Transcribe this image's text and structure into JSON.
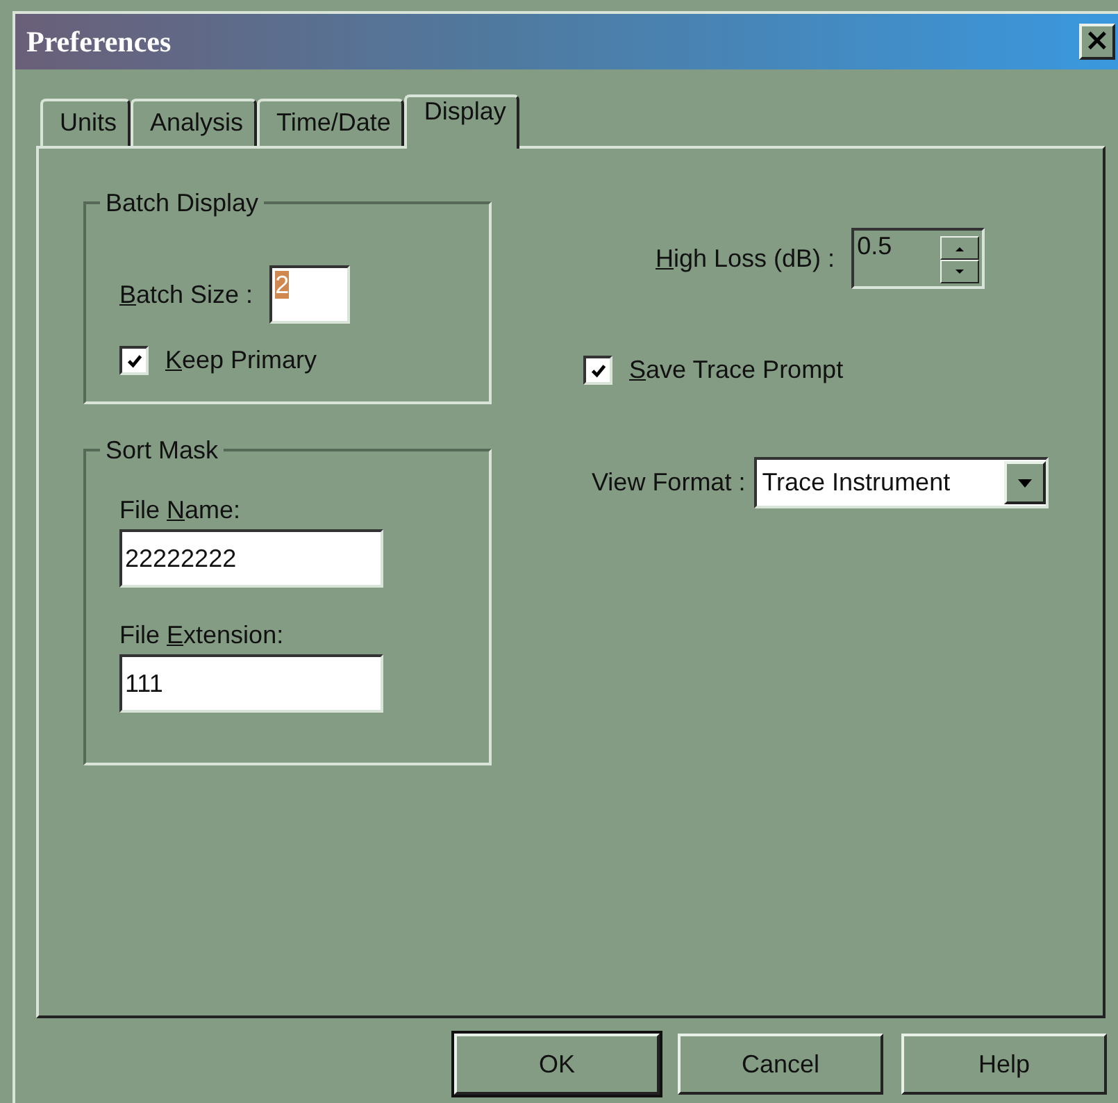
{
  "window": {
    "title": "Preferences",
    "close": "×"
  },
  "tabs": [
    {
      "label": "Units",
      "selected": false
    },
    {
      "label": "Analysis",
      "selected": false
    },
    {
      "label": "Time/Date",
      "selected": false
    },
    {
      "label": "Display",
      "selected": true
    }
  ],
  "batch_display": {
    "title": "Batch Display",
    "batch_size": {
      "accelerator": "B",
      "label_rest": "atch Size :",
      "value": "2",
      "highlighted": true
    },
    "keep_primary": {
      "accelerator": "K",
      "label_rest": "eep Primary",
      "checked": true
    }
  },
  "sort_mask": {
    "title": "Sort Mask",
    "fields": [
      {
        "label_start": "File ",
        "accelerator": "N",
        "label_rest": "ame:",
        "value": "22222222"
      },
      {
        "label_start": "File ",
        "accelerator": "E",
        "label_rest": "xtension:",
        "value": "111"
      }
    ]
  },
  "high_loss": {
    "accelerator": "H",
    "label_rest": "igh Loss (dB) :",
    "value": "0.5"
  },
  "save_trace_prompt": {
    "accelerator": "S",
    "label_rest": "ave Trace Prompt",
    "checked": true
  },
  "view_format": {
    "label": "View Format :",
    "value": "Trace Instrument"
  },
  "buttons": [
    {
      "label": "OK",
      "default": true
    },
    {
      "label": "Cancel",
      "default": false
    },
    {
      "label": "Help",
      "default": false
    }
  ]
}
